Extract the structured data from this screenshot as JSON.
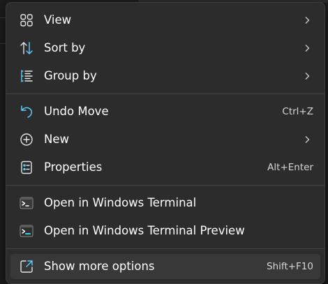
{
  "menu": {
    "items": [
      {
        "label": "View",
        "icon": "grid-view-icon",
        "submenu": true
      },
      {
        "label": "Sort by",
        "icon": "sort-arrows-icon",
        "submenu": true
      },
      {
        "label": "Group by",
        "icon": "group-list-icon",
        "submenu": true
      },
      {
        "label": "Undo Move",
        "icon": "undo-icon",
        "shortcut": "Ctrl+Z"
      },
      {
        "label": "New",
        "icon": "plus-circle-icon",
        "submenu": true
      },
      {
        "label": "Properties",
        "icon": "properties-icon",
        "shortcut": "Alt+Enter"
      },
      {
        "label": "Open in Windows Terminal",
        "icon": "terminal-icon"
      },
      {
        "label": "Open in Windows Terminal Preview",
        "icon": "terminal-preview-icon"
      },
      {
        "label": "Show more options",
        "icon": "show-more-options-icon",
        "shortcut": "Shift+F10",
        "highlighted": true
      }
    ]
  },
  "colors": {
    "menu_background": "#2c2c2c",
    "highlight": "#383838",
    "accent_blue": "#60cdff",
    "text": "#ffffff"
  }
}
